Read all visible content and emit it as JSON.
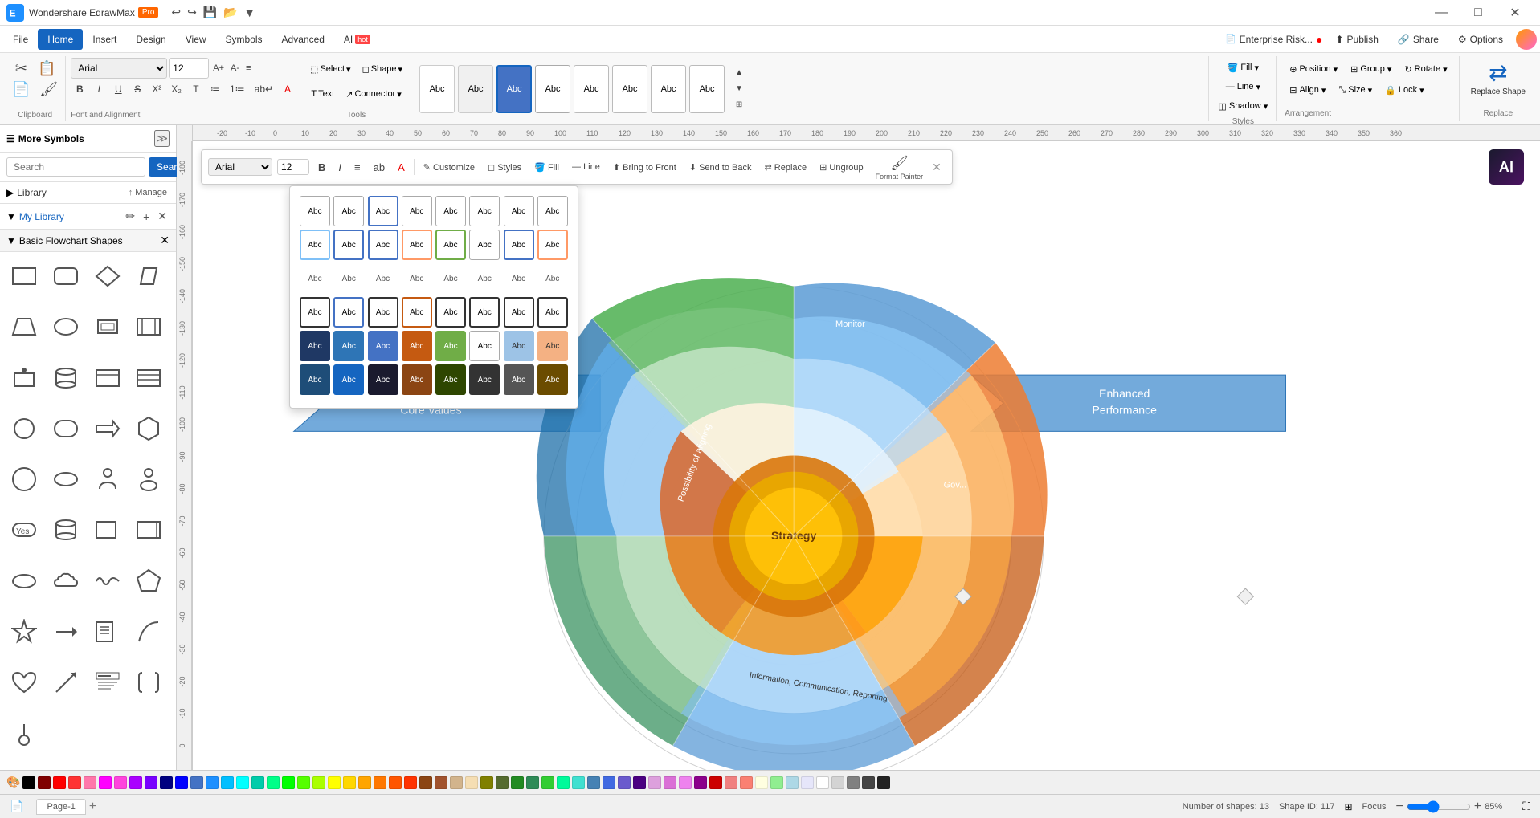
{
  "app": {
    "name": "Wondershare EdrawMax",
    "pro_label": "Pro",
    "file_title": "Enterprise Risk..."
  },
  "titlebar": {
    "undo": "↩",
    "redo": "↪",
    "save": "💾",
    "open": "📂",
    "minimize": "—",
    "maximize": "□",
    "close": "✕"
  },
  "menubar": {
    "items": [
      "File",
      "Home",
      "Insert",
      "Design",
      "View",
      "Symbols",
      "Advanced",
      "AI"
    ],
    "active": "Home",
    "ai_badge": "hot",
    "right_items": [
      "Publish",
      "Share",
      "Options"
    ]
  },
  "toolbar": {
    "clipboard_label": "Clipboard",
    "font_label": "Font and Alignment",
    "tools_label": "Tools",
    "styles_label": "Styles",
    "arrangement_label": "Arrangement",
    "replace_label": "Replace",
    "font_family": "Arial",
    "font_size": "12",
    "select_label": "Select",
    "shape_label": "Shape",
    "text_label": "Text",
    "connector_label": "Connector",
    "fill_label": "Fill",
    "line_label": "Line",
    "shadow_label": "Shadow",
    "position_label": "Position",
    "group_label": "Group",
    "rotate_label": "Rotate",
    "align_label": "Align",
    "size_label": "Size",
    "lock_label": "Lock",
    "replace_shape_label": "Replace Shape",
    "format_painter_label": "Format Painter",
    "style_boxes": [
      "Abc",
      "Abc",
      "Abc",
      "Abc",
      "Abc",
      "Abc",
      "Abc",
      "Abc"
    ],
    "style_selected": 2
  },
  "left_panel": {
    "title": "More Symbols",
    "search_placeholder": "Search",
    "search_btn": "Search",
    "library_label": "Library",
    "my_library_label": "My Library",
    "manage_label": "Manage",
    "category_label": "Basic Flowchart Shapes"
  },
  "floating_toolbar": {
    "font": "Arial",
    "size": "12",
    "bold": "B",
    "italic": "I",
    "align": "≡",
    "ab_label": "ab",
    "a_label": "A",
    "customize_label": "Customize",
    "styles_label": "Styles",
    "fill_label": "Fill",
    "line_label": "Line",
    "bring_front_label": "Bring to Front",
    "send_back_label": "Send to Back",
    "replace_label": "Replace",
    "ungroup_label": "Ungroup",
    "format_painter_label": "Format Painter"
  },
  "style_picker": {
    "rows": [
      [
        "Abc",
        "Abc",
        "Abc",
        "Abc",
        "Abc",
        "Abc",
        "Abc",
        "Abc"
      ],
      [
        "Abc",
        "Abc",
        "Abc",
        "Abc",
        "Abc",
        "Abc",
        "Abc",
        "Abc"
      ],
      [
        "Abc",
        "Abc",
        "Abc",
        "Abc",
        "Abc",
        "Abc",
        "Abc",
        "Abc"
      ],
      [
        "Abc",
        "Abc",
        "Abc",
        "Abc",
        "Abc",
        "Abc",
        "Abc",
        "Abc"
      ],
      [
        "Abc",
        "Abc",
        "Abc",
        "Abc",
        "Abc",
        "Abc",
        "Abc",
        "Abc"
      ],
      [
        "Abc",
        "Abc",
        "Abc",
        "Abc",
        "Abc",
        "Abc",
        "Abc",
        "Abc"
      ]
    ],
    "row_styles": [
      [
        "border-plain",
        "border-plain",
        "border-blue",
        "border-plain",
        "border-plain",
        "border-plain",
        "border-plain",
        "border-plain"
      ],
      [
        "border-blue-light",
        "border-blue",
        "border-blue",
        "border-orange",
        "border-green",
        "border-plain",
        "border-blue",
        "border-orange"
      ],
      [
        "no-border",
        "no-border",
        "no-border",
        "no-border",
        "no-border",
        "no-border",
        "no-border",
        "no-border"
      ],
      [
        "border-dark",
        "border-dark",
        "border-dark",
        "border-dark",
        "border-dark",
        "border-dark",
        "border-dark",
        "border-dark"
      ],
      [
        "fill-dark-blue",
        "fill-blue",
        "fill-blue",
        "fill-orange",
        "fill-green",
        "fill-plain",
        "fill-blue",
        "fill-orange"
      ],
      [
        "fill-dark-teal",
        "fill-blue-dark",
        "fill-dark",
        "fill-brown",
        "fill-dark",
        "fill-dark",
        "fill-dark",
        "fill-dark"
      ]
    ]
  },
  "diagram": {
    "mission_label": "Mission , Vision, and Core Values",
    "strategy_label": "Strategy",
    "performance_label": "Enhanced Performance",
    "aligning_label": "Possibility of aligning",
    "monitor_label": "Monitor",
    "governance_label": "Gov...",
    "info_label": "Information, Communication, Reporting"
  },
  "colors": [
    "#FF0000",
    "#FF1111",
    "#FF3333",
    "#FF5555",
    "#FF77AA",
    "#FF00FF",
    "#AA00FF",
    "#7700FF",
    "#0000FF",
    "#0055FF",
    "#0099FF",
    "#00BBFF",
    "#00FFFF",
    "#00FFAA",
    "#00FF55",
    "#00FF00",
    "#55FF00",
    "#AAFF00",
    "#FFFF00",
    "#FFAA00",
    "#FF7700",
    "#FF5500",
    "#FF3300",
    "#FF0000"
  ],
  "statusbar": {
    "shapes_count": "Number of shapes: 13",
    "shape_id": "Shape ID: 117",
    "focus_label": "Focus",
    "zoom_level": "85%",
    "page_label": "Page-1"
  },
  "tabs": [
    {
      "label": "Page-1",
      "active": true
    }
  ]
}
